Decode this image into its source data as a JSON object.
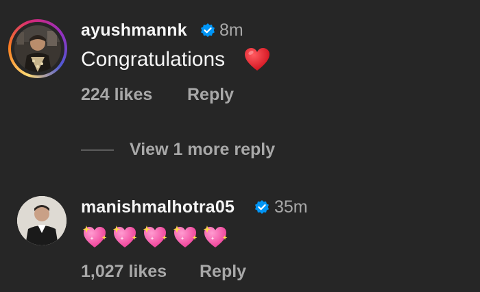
{
  "comments": [
    {
      "username": "ayushmannk",
      "time": "8m",
      "text": "Congratulations",
      "emoji": "heart-red",
      "likes": "224 likes",
      "reply_label": "Reply"
    },
    {
      "username": "manishmalhotra05",
      "time": "35m",
      "emoji": "sparkling-heart",
      "emoji_count": 5,
      "likes": "1,027 likes",
      "reply_label": "Reply"
    }
  ],
  "view_more_label": "View 1 more reply",
  "colors": {
    "background": "#262626",
    "primary_text": "#f5f5f5",
    "secondary_text": "#a8a8a8",
    "verified_blue": "#0095f6",
    "heart_red": "#e8202a",
    "sparkle_pink": "#ff4fa6"
  },
  "icons": [
    "verified-badge-icon",
    "red-heart-emoji",
    "sparkling-heart-emoji"
  ]
}
